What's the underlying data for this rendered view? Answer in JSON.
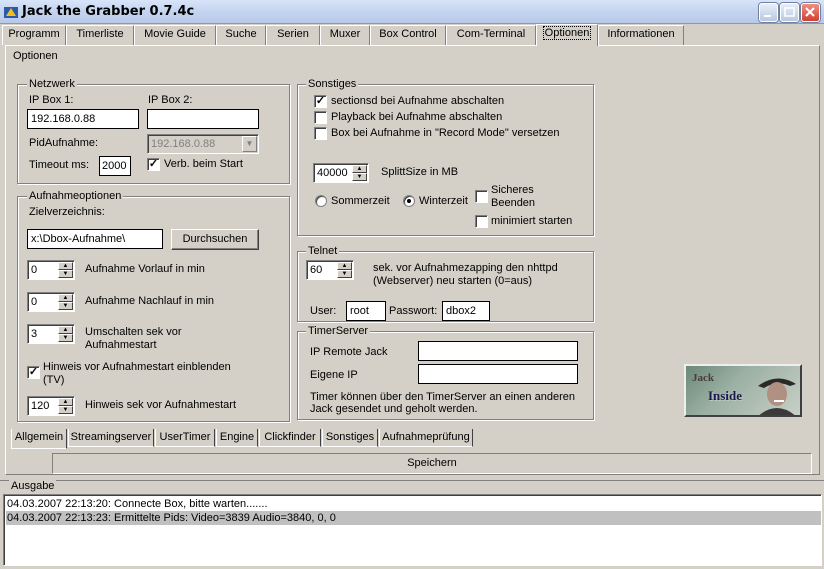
{
  "window": {
    "title": "Jack the Grabber 0.7.4c"
  },
  "top_tabs": [
    "Programm",
    "Timerliste",
    "Movie Guide",
    "Suche",
    "Serien",
    "Muxer",
    "Box Control",
    "Com-Terminal",
    "Optionen",
    "Informationen"
  ],
  "active_top_tab": "Optionen",
  "optionen_label": "Optionen",
  "netzwerk": {
    "legend": "Netzwerk",
    "ip_box1_label": "IP Box 1:",
    "ip_box1_value": "192.168.0.88",
    "ip_box2_label": "IP Box 2:",
    "ip_box2_value": "",
    "pid_label": "PidAufnahme:",
    "pid_value": "192.168.0.88",
    "timeout_label": "Timeout ms:",
    "timeout_value": "2000",
    "verb_label": "Verb. beim Start",
    "verb_checked": true
  },
  "aufnahme": {
    "legend": "Aufnahmeoptionen",
    "ziel_label": "Zielverzeichnis:",
    "ziel_value": "x:\\Dbox-Aufnahme\\",
    "browse_label": "Durchsuchen",
    "vorlauf_value": "0",
    "vorlauf_label": "Aufnahme Vorlauf in min",
    "nachlauf_value": "0",
    "nachlauf_label": "Aufnahme Nachlauf in min",
    "umschalten_value": "3",
    "umschalten_label1": "Umschalten sek vor",
    "umschalten_label2": "Aufnahmestart",
    "hinweis_label1": "Hinweis vor Aufnahmestart einblenden",
    "hinweis_label2": "(TV)",
    "hinweis_checked": true,
    "hinweis_sek_value": "120",
    "hinweis_sek_label": "Hinweis sek vor Aufnahmestart"
  },
  "sonstiges": {
    "legend": "Sonstiges",
    "opt1_label": "sectionsd bei Aufnahme abschalten",
    "opt1_checked": true,
    "opt2_label": "Playback bei Aufnahme abschalten",
    "opt2_checked": false,
    "opt3_label": "Box bei Aufnahme in \"Record Mode\" versetzen",
    "opt3_checked": false,
    "split_value": "40000",
    "split_label": "SplittSize in MB",
    "sommer_label": "Sommerzeit",
    "winter_label": "Winterzeit",
    "zeit_selected": "Winterzeit",
    "sicheres_label1": "Sicheres",
    "sicheres_label2": "Beenden",
    "sicheres_checked": false,
    "minimiert_label": "minimiert starten",
    "minimiert_checked": false
  },
  "telnet": {
    "legend": "Telnet",
    "sek_value": "60",
    "sek_label1": "sek. vor Aufnahmezapping den nhttpd",
    "sek_label2": "(Webserver) neu starten (0=aus)",
    "user_label": "User:",
    "user_value": "root",
    "pass_label": "Passwort:",
    "pass_value": "dbox2"
  },
  "timerserver": {
    "legend": "TimerServer",
    "remote_label": "IP Remote Jack",
    "remote_value": "",
    "eigene_label": "Eigene IP",
    "eigene_value": "",
    "info1": "Timer können über den TimerServer an einen anderen",
    "info2": "Jack gesendet und geholt werden."
  },
  "logo": {
    "line1": "Jack",
    "line2": "Inside"
  },
  "bottom_tabs": [
    "Allgemein",
    "Streamingserver",
    "UserTimer",
    "Engine",
    "Clickfinder",
    "Sonstiges",
    "Aufnahmeprüfung"
  ],
  "active_bottom_tab": "Allgemein",
  "save_label": "Speichern",
  "ausgabe": {
    "label": "Ausgabe",
    "lines": [
      "04.03.2007 22:13:20: Connecte Box, bitte warten.......",
      "04.03.2007 22:13:23: Ermittelte Pids: Video=3839 Audio=3840, 0, 0"
    ],
    "selected_index": 1
  },
  "colors": {
    "titlebar": "#c4d4f0",
    "face": "#d4d0c8",
    "selection": "#c0c0c0"
  }
}
